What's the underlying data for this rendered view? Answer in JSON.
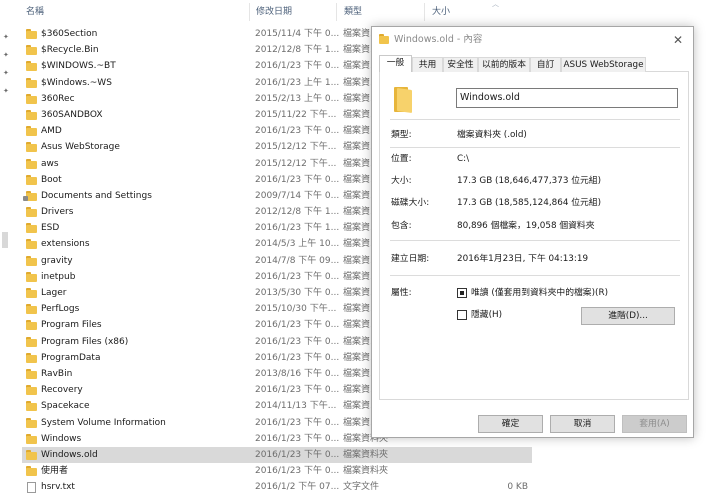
{
  "explorer": {
    "columns": {
      "name": "名稱",
      "date": "修改日期",
      "type": "類型",
      "size": "大小"
    },
    "rows": [
      {
        "name": "$360Section",
        "date": "2015/11/4 下午 0...",
        "type": "檔案資...",
        "size": "",
        "icon": "folder-icon"
      },
      {
        "name": "$Recycle.Bin",
        "date": "2012/12/8 下午 1...",
        "type": "檔案資...",
        "size": "",
        "icon": "folder-icon"
      },
      {
        "name": "$WINDOWS.~BT",
        "date": "2016/1/23 下午 0...",
        "type": "檔案資...",
        "size": "",
        "icon": "folder-icon"
      },
      {
        "name": "$Windows.~WS",
        "date": "2016/1/23 上午 1...",
        "type": "檔案資...",
        "size": "",
        "icon": "folder-icon"
      },
      {
        "name": "360Rec",
        "date": "2015/2/13 上午 0...",
        "type": "檔案資...",
        "size": "",
        "icon": "folder-icon"
      },
      {
        "name": "360SANDBOX",
        "date": "2015/11/22 下午...",
        "type": "檔案資...",
        "size": "",
        "icon": "folder-icon"
      },
      {
        "name": "AMD",
        "date": "2016/1/23 下午 0...",
        "type": "檔案資...",
        "size": "",
        "icon": "folder-icon"
      },
      {
        "name": "Asus WebStorage",
        "date": "2015/12/12 下午...",
        "type": "檔案資...",
        "size": "",
        "icon": "folder-icon"
      },
      {
        "name": "aws",
        "date": "2015/12/12 下午...",
        "type": "檔案資...",
        "size": "",
        "icon": "folder-icon"
      },
      {
        "name": "Boot",
        "date": "2016/1/23 下午 0...",
        "type": "檔案資...",
        "size": "",
        "icon": "folder-icon"
      },
      {
        "name": "Documents and Settings",
        "date": "2009/7/14 下午 0...",
        "type": "檔案資...",
        "size": "",
        "icon": "folder-shortcut-icon"
      },
      {
        "name": "Drivers",
        "date": "2012/12/8 下午 1...",
        "type": "檔案資...",
        "size": "",
        "icon": "folder-icon"
      },
      {
        "name": "ESD",
        "date": "2016/1/23 下午 1...",
        "type": "檔案資...",
        "size": "",
        "icon": "folder-icon"
      },
      {
        "name": "extensions",
        "date": "2014/5/3 上午 10...",
        "type": "檔案資...",
        "size": "",
        "icon": "folder-icon"
      },
      {
        "name": "gravity",
        "date": "2014/7/8 下午 09...",
        "type": "檔案資...",
        "size": "",
        "icon": "folder-icon"
      },
      {
        "name": "inetpub",
        "date": "2016/1/23 下午 0...",
        "type": "檔案資...",
        "size": "",
        "icon": "folder-icon"
      },
      {
        "name": "Lager",
        "date": "2013/5/30 下午 0...",
        "type": "檔案資...",
        "size": "",
        "icon": "folder-icon"
      },
      {
        "name": "PerfLogs",
        "date": "2015/10/30 下午...",
        "type": "檔案資...",
        "size": "",
        "icon": "folder-icon"
      },
      {
        "name": "Program Files",
        "date": "2016/1/23 下午 0...",
        "type": "檔案資...",
        "size": "",
        "icon": "folder-icon"
      },
      {
        "name": "Program Files (x86)",
        "date": "2016/1/23 下午 0...",
        "type": "檔案資...",
        "size": "",
        "icon": "folder-icon"
      },
      {
        "name": "ProgramData",
        "date": "2016/1/23 下午 0...",
        "type": "檔案資...",
        "size": "",
        "icon": "folder-icon"
      },
      {
        "name": "RavBin",
        "date": "2013/8/16 下午 0...",
        "type": "檔案資...",
        "size": "",
        "icon": "folder-icon"
      },
      {
        "name": "Recovery",
        "date": "2016/1/23 下午 0...",
        "type": "檔案資...",
        "size": "",
        "icon": "folder-icon"
      },
      {
        "name": "Spacekace",
        "date": "2014/11/13 下午...",
        "type": "檔案資...",
        "size": "",
        "icon": "folder-icon"
      },
      {
        "name": "System Volume Information",
        "date": "2016/1/23 下午 0...",
        "type": "檔案資...",
        "size": "",
        "icon": "folder-icon"
      },
      {
        "name": "Windows",
        "date": "2016/1/23 下午 0...",
        "type": "檔案資料夾",
        "size": "",
        "icon": "folder-icon"
      },
      {
        "name": "Windows.old",
        "date": "2016/1/23 下午 0...",
        "type": "檔案資料夾",
        "size": "",
        "icon": "folder-icon",
        "selected": true
      },
      {
        "name": "使用者",
        "date": "2016/1/23 下午 0...",
        "type": "檔案資料夾",
        "size": "",
        "icon": "folder-icon"
      },
      {
        "name": "hsrv.txt",
        "date": "2016/1/2 下午 07...",
        "type": "文字文件",
        "size": "0 KB",
        "icon": "text-file-icon"
      }
    ]
  },
  "dialog": {
    "title": "Windows.old - 內容",
    "close_glyph": "✕",
    "tabs": [
      "一般",
      "共用",
      "安全性",
      "以前的版本",
      "自訂",
      "ASUS WebStorage"
    ],
    "active_tab": "一般",
    "name_value": "Windows.old",
    "props": {
      "type_label": "類型:",
      "type_value": "檔案資料夾 (.old)",
      "location_label": "位置:",
      "location_value": "C:\\",
      "size_label": "大小:",
      "size_value": "17.3 GB (18,646,477,373 位元組)",
      "disk_label": "磁碟大小:",
      "disk_value": "17.3 GB (18,585,124,864 位元組)",
      "contains_label": "包含:",
      "contains_value": "80,896 個檔案，19,058 個資料夾",
      "created_label": "建立日期:",
      "created_value": "2016年1月23日, 下午 04:13:19",
      "attr_label": "屬性:",
      "readonly_label": "唯讀 (僅套用到資料夾中的檔案)(R)",
      "hidden_label": "隱藏(H)",
      "advanced_label": "進階(D)..."
    },
    "buttons": {
      "ok": "確定",
      "cancel": "取消",
      "apply": "套用(A)"
    }
  }
}
